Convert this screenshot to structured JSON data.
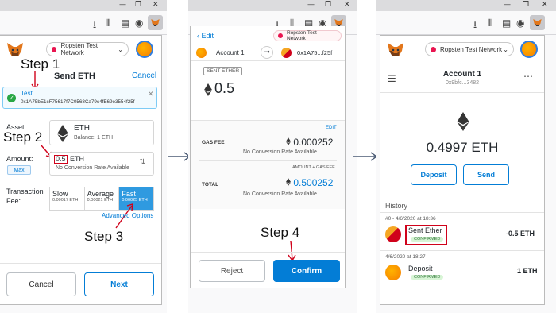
{
  "left": {
    "network": "Ropsten Test Network",
    "step1": "Step 1",
    "title": "Send ETH",
    "cancel": "Cancel",
    "recipient_name": "Test",
    "recipient_addr": "0x1A75bE1cF75617f7C0568Ca79c4fE69e3554f25f",
    "asset_label": "Asset:",
    "asset_name": "ETH",
    "asset_balance": "Balance: 1 ETH",
    "step2": "Step 2",
    "amount_label": "Amount:",
    "max": "Max",
    "amount_value": "0.5",
    "amount_unit": "ETH",
    "no_conversion": "No Conversion Rate Available",
    "fee_label": "Transaction Fee:",
    "fee_options": [
      {
        "name": "Slow",
        "amount": "0.00017 ETH"
      },
      {
        "name": "Average",
        "amount": "0.00021 ETH"
      },
      {
        "name": "Fast",
        "amount": "0.00025 ETH"
      }
    ],
    "advanced": "Advanced Options",
    "step3": "Step 3",
    "btn_cancel": "Cancel",
    "btn_next": "Next"
  },
  "middle": {
    "edit": "Edit",
    "network": "Ropsten Test Network",
    "from_account": "Account 1",
    "to_addr": "0x1A75...f25f",
    "sent_badge": "SENT ETHER",
    "amount": "0.5",
    "edit_link": "EDIT",
    "gas_label": "GAS FEE",
    "gas_value": "0.000252",
    "gas_conversion": "No Conversion Rate Available",
    "amount_gas_label": "AMOUNT + GAS FEE",
    "total_label": "TOTAL",
    "total_value": "0.500252",
    "total_conversion": "No Conversion Rate Available",
    "step4": "Step 4",
    "reject": "Reject",
    "confirm": "Confirm"
  },
  "right": {
    "network": "Ropsten Test Network",
    "account_name": "Account 1",
    "account_addr": "0x9bfc...3482",
    "balance": "0.4997 ETH",
    "deposit": "Deposit",
    "send": "Send",
    "history": "History",
    "tx1_meta": "#0 - 4/6/2020 at 18:36",
    "tx1_title": "Sent Ether",
    "tx1_status": "CONFIRMED",
    "tx1_amount": "-0.5 ETH",
    "tx2_meta": "4/6/2020 at 18:27",
    "tx2_title": "Deposit",
    "tx2_status": "CONFIRMED",
    "tx2_amount": "1 ETH"
  },
  "colors": {
    "accent": "#037dd6",
    "red": "#d0021b",
    "green_badge": "#d8f5d6",
    "fast_bg": "#2f9ae0"
  }
}
